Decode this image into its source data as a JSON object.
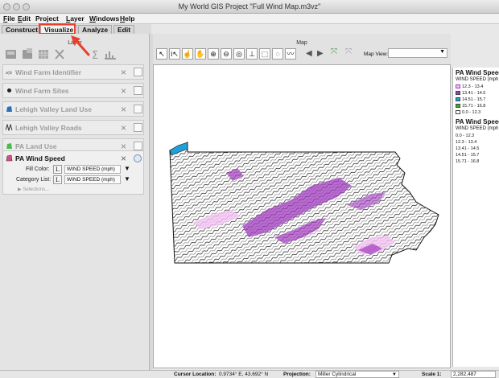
{
  "window": {
    "title": "My World GIS Project \"Full Wind Map.m3vz\""
  },
  "menubar": {
    "items": [
      {
        "underline": "F",
        "rest": "ile"
      },
      {
        "underline": "E",
        "rest": "dit"
      },
      {
        "underline": "",
        "rest": "Project"
      },
      {
        "underline": "L",
        "rest": "ayer"
      },
      {
        "underline": "W",
        "rest": "indows"
      },
      {
        "underline": "H",
        "rest": "elp"
      }
    ]
  },
  "tabs": [
    {
      "label": "Construct"
    },
    {
      "label": "Visualize"
    },
    {
      "label": "Analyze"
    },
    {
      "label": "Edit"
    }
  ],
  "layer_pane": {
    "title": "Layer",
    "layers": [
      {
        "label": "Wind Farm Identifier",
        "icon": "identifier-icon"
      },
      {
        "label": "Wind Farm Sites",
        "icon": "point-layer-icon"
      },
      {
        "label": "Lehigh Valley Land Use",
        "icon": "polygon-layer-icon"
      },
      {
        "label": "Lehigh Valley Roads",
        "icon": "line-layer-icon"
      },
      {
        "label": "PA Land Use",
        "icon": "polygon-layer-icon"
      }
    ],
    "selected_layer": {
      "label": "PA Wind Speed",
      "fill_color_label": "Fill Color:",
      "fill_color_value": "WIND SPEED (mph)",
      "category_list_label": "Category List:",
      "category_list_value": "WIND SPEED (mph)",
      "selections_label": "Selections..."
    }
  },
  "map_pane": {
    "title": "Map",
    "map_view_label": "Map View:",
    "map_view_value": ""
  },
  "legend": {
    "title": "PA Wind Speed",
    "subtitle": "WIND SPEED (mph",
    "items": [
      {
        "label": "12.3 - 13.4",
        "color": "#f4c2f4"
      },
      {
        "label": "13.41 - 14.5",
        "color": "#a23bbf"
      },
      {
        "label": "14.51 - 15.7",
        "color": "#20a0d8"
      },
      {
        "label": "15.71 - 16.8",
        "color": "#33b033"
      },
      {
        "label": "0.0 - 12.3",
        "color": "#ffffff"
      }
    ],
    "category_title": "PA Wind Speed",
    "category_subtitle": "WIND SPEED (mph",
    "category_items": [
      "0.0 - 12.3",
      "12.3 - 13.4",
      "13.41 - 14.5",
      "14.51 - 15.7",
      "15.71 - 16.8"
    ]
  },
  "statusbar": {
    "cursor_label": "Cursor Location:",
    "cursor_value": "0.9734° E, 43.692° N",
    "projection_label": "Projection:",
    "projection_value": "Miller Cylindrical",
    "scale_label": "Scale 1:",
    "scale_value": "2,282,487"
  },
  "colors": {
    "annotation_red": "#e8402a",
    "purple_high": "#a23bbf",
    "light_purple": "#f4c2f4",
    "blue": "#20a0d8",
    "green": "#33b033"
  }
}
